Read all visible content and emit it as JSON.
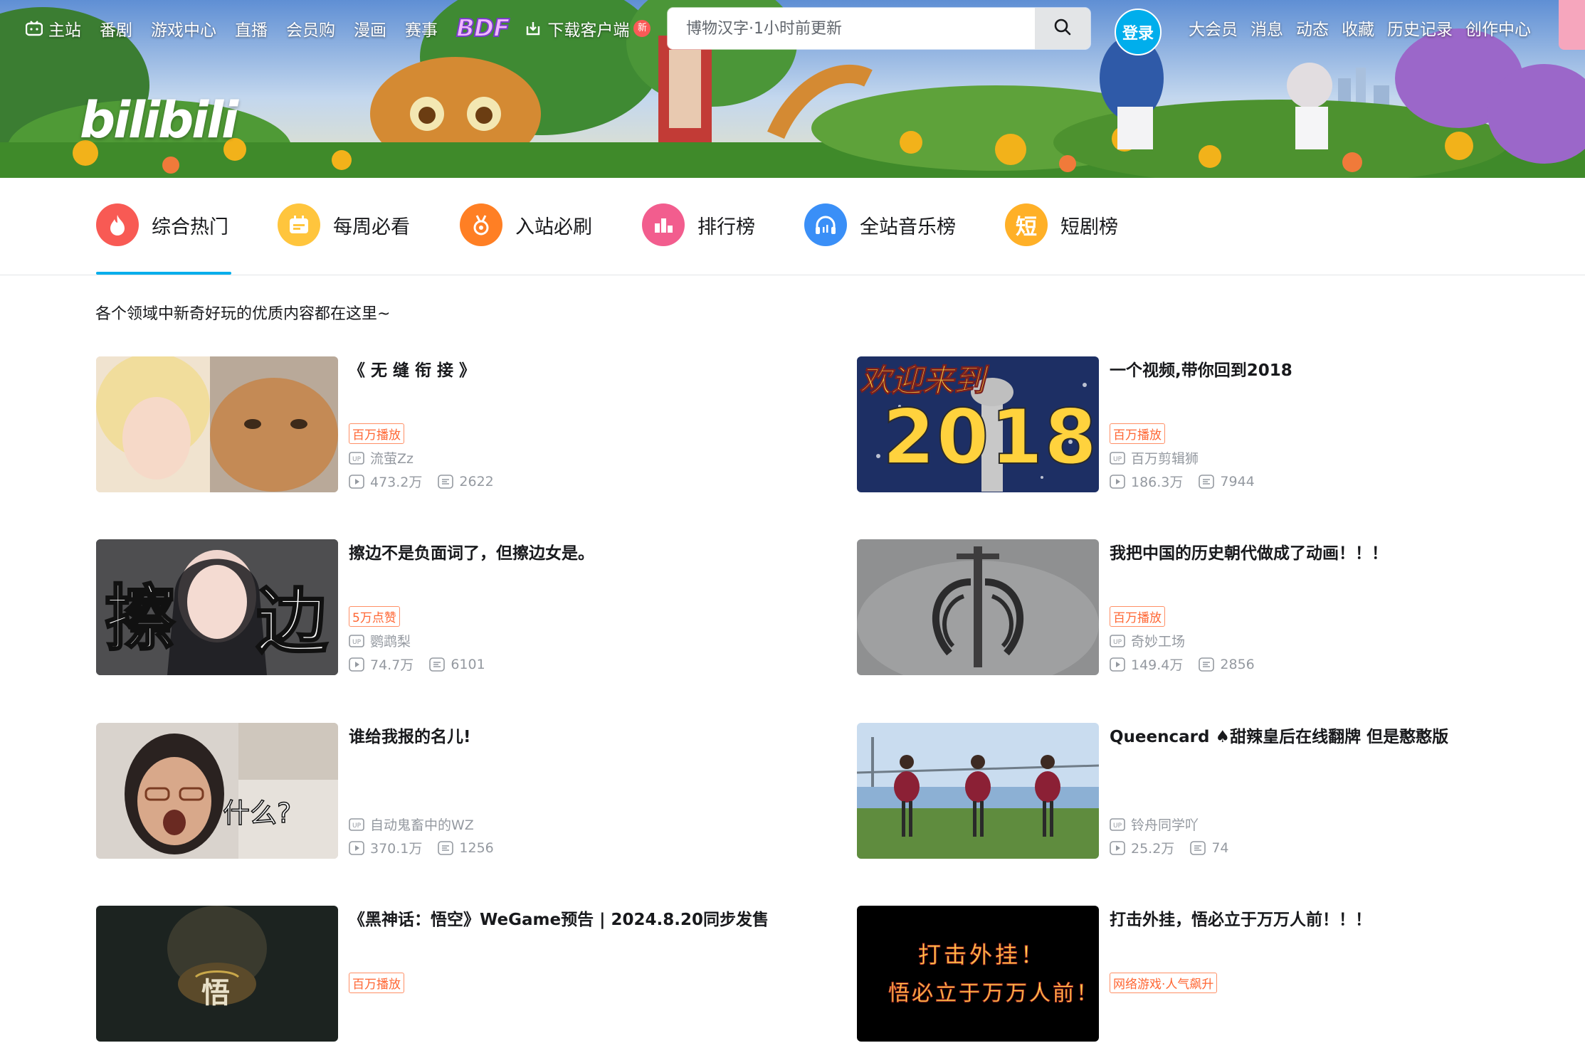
{
  "nav": {
    "left": [
      {
        "label": "主站",
        "icon": "tv-icon"
      },
      {
        "label": "番剧"
      },
      {
        "label": "游戏中心"
      },
      {
        "label": "直播"
      },
      {
        "label": "会员购"
      },
      {
        "label": "漫画"
      },
      {
        "label": "赛事"
      }
    ],
    "bdf": "BDF",
    "download": {
      "label": "下载客户端",
      "badge": "新"
    },
    "right": [
      "大会员",
      "消息",
      "动态",
      "收藏",
      "历史记录",
      "创作中心"
    ]
  },
  "search": {
    "placeholder": "博物汉字·1小时前更新"
  },
  "login": "登录",
  "logo": "bilibili",
  "tabs": [
    {
      "label": "综合热门",
      "color": "#f85a54",
      "icon": "fire-icon"
    },
    {
      "label": "每周必看",
      "color": "#ffb027",
      "icon": "calendar-icon"
    },
    {
      "label": "入站必刷",
      "color": "#ff7f24",
      "icon": "medal-icon"
    },
    {
      "label": "排行榜",
      "color": "#f25d8e",
      "icon": "ranking-icon"
    },
    {
      "label": "全站音乐榜",
      "color": "#3a8ff7",
      "icon": "headphones-icon"
    },
    {
      "label": "短剧榜",
      "color": "#ffb027",
      "icon": "short-drama-icon"
    }
  ],
  "tagline": "各个领域中新奇好玩的优质内容都在这里~",
  "videos": [
    {
      "title": "《 无 缝 衔 接 》",
      "tag": "百万播放",
      "up": "流萤Zz",
      "views": "473.2万",
      "danmaku": "2622"
    },
    {
      "title": "一个视频,带你回到2018",
      "tag": "百万播放",
      "up": "百万剪辑狮",
      "views": "186.3万",
      "danmaku": "7944",
      "thumb_text": [
        "欢迎来到",
        "2018"
      ]
    },
    {
      "title": "擦边不是负面词了，但擦边女是。",
      "tag": "5万点赞",
      "up": "鹦鹉梨",
      "views": "74.7万",
      "danmaku": "6101",
      "thumb_text": [
        "擦",
        "边"
      ]
    },
    {
      "title": "我把中国的历史朝代做成了动画！！！",
      "tag": "百万播放",
      "up": "奇妙工场",
      "views": "149.4万",
      "danmaku": "2856"
    },
    {
      "title": "谁给我报的名儿!",
      "tag": "",
      "up": "自动鬼畜中的WZ",
      "views": "370.1万",
      "danmaku": "1256",
      "thumb_text": [
        "什么?"
      ]
    },
    {
      "title": "Queencard ♠甜辣皇后在线翻牌 但是憨憨版",
      "tag": "",
      "up": "铃舟同学吖",
      "views": "25.2万",
      "danmaku": "74"
    },
    {
      "title": "《黑神话：悟空》WeGame预告 | 2024.8.20同步发售",
      "tag": "百万播放",
      "up": "",
      "views": "",
      "danmaku": "",
      "thumb_text": [
        "悟"
      ]
    },
    {
      "title": "打击外挂，悟必立于万万人前！！！",
      "tag": "网络游戏·人气飙升",
      "up": "",
      "views": "",
      "danmaku": "",
      "thumb_text": [
        "打击外挂！",
        "悟必立于万万人前！"
      ]
    }
  ]
}
